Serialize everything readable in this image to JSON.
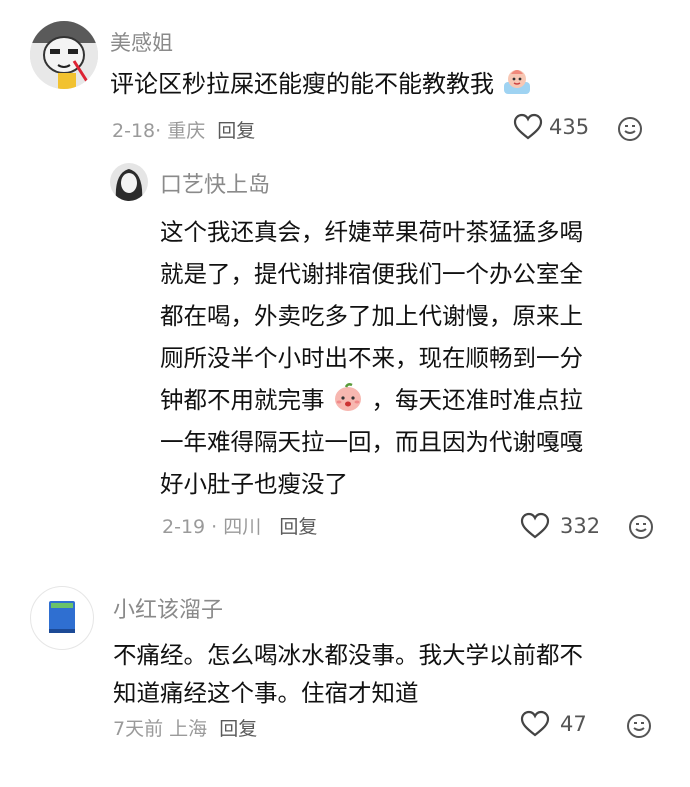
{
  "comments": [
    {
      "username": "美感姐",
      "text": "评论区秒拉屎还能瘦的能不能教教我",
      "date": "2-18",
      "location": "重庆",
      "reply_label": "回复",
      "likes": "435"
    },
    {
      "username": "口艺快上岛",
      "lines": [
        "这个我还真会，纤婕苹果荷叶茶猛猛多喝",
        "就是了，提代谢排宿便我们一个办公室全",
        "都在喝，外卖吃多了加上代谢慢，原来上",
        "厕所没半个小时出不来，现在顺畅到一分",
        "钟都不用就完事",
        "，每天还准时准点拉",
        "一年难得隔天拉一回，而且因为代谢嘎嘎",
        "好小肚子也瘦没了"
      ],
      "date": "2-19",
      "location": "四川",
      "reply_label": "回复",
      "likes": "332"
    },
    {
      "username": "小红该溜子",
      "lines": [
        "不痛经。怎么喝冰水都没事。我大学以前都不",
        "知道痛经这个事。住宿才知道"
      ],
      "date": "7天前",
      "location": "上海",
      "reply_label": "回复",
      "likes": "47"
    }
  ],
  "icons": {
    "like": "heart-outline-icon",
    "emoji": "smiley-face-icon"
  }
}
